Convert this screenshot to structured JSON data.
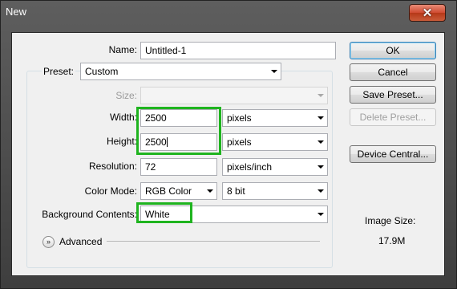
{
  "window": {
    "title": "New",
    "close_glyph": "✕"
  },
  "form": {
    "name_label": "Name:",
    "name_value": "Untitled-1",
    "preset_label": "Preset:",
    "preset_value": "Custom",
    "size_label": "Size:",
    "size_value": "",
    "width_label": "Width:",
    "width_value": "2500",
    "width_unit": "pixels",
    "height_label": "Height:",
    "height_value": "2500",
    "height_unit": "pixels",
    "resolution_label": "Resolution:",
    "resolution_value": "72",
    "resolution_unit": "pixels/inch",
    "color_mode_label": "Color Mode:",
    "color_mode_value": "RGB Color",
    "bit_depth_value": "8 bit",
    "background_label": "Background Contents:",
    "background_value": "White",
    "advanced_label": "Advanced",
    "expander_glyph": "»"
  },
  "buttons": {
    "ok": "OK",
    "cancel": "Cancel",
    "save_preset": "Save Preset...",
    "delete_preset": "Delete Preset...",
    "device_central": "Device Central..."
  },
  "info": {
    "image_size_label": "Image Size:",
    "image_size_value": "17.9M"
  },
  "colors": {
    "highlight": "#1fb41f",
    "close_button": "#c9472b",
    "default_button_border": "#3c7fb1"
  }
}
